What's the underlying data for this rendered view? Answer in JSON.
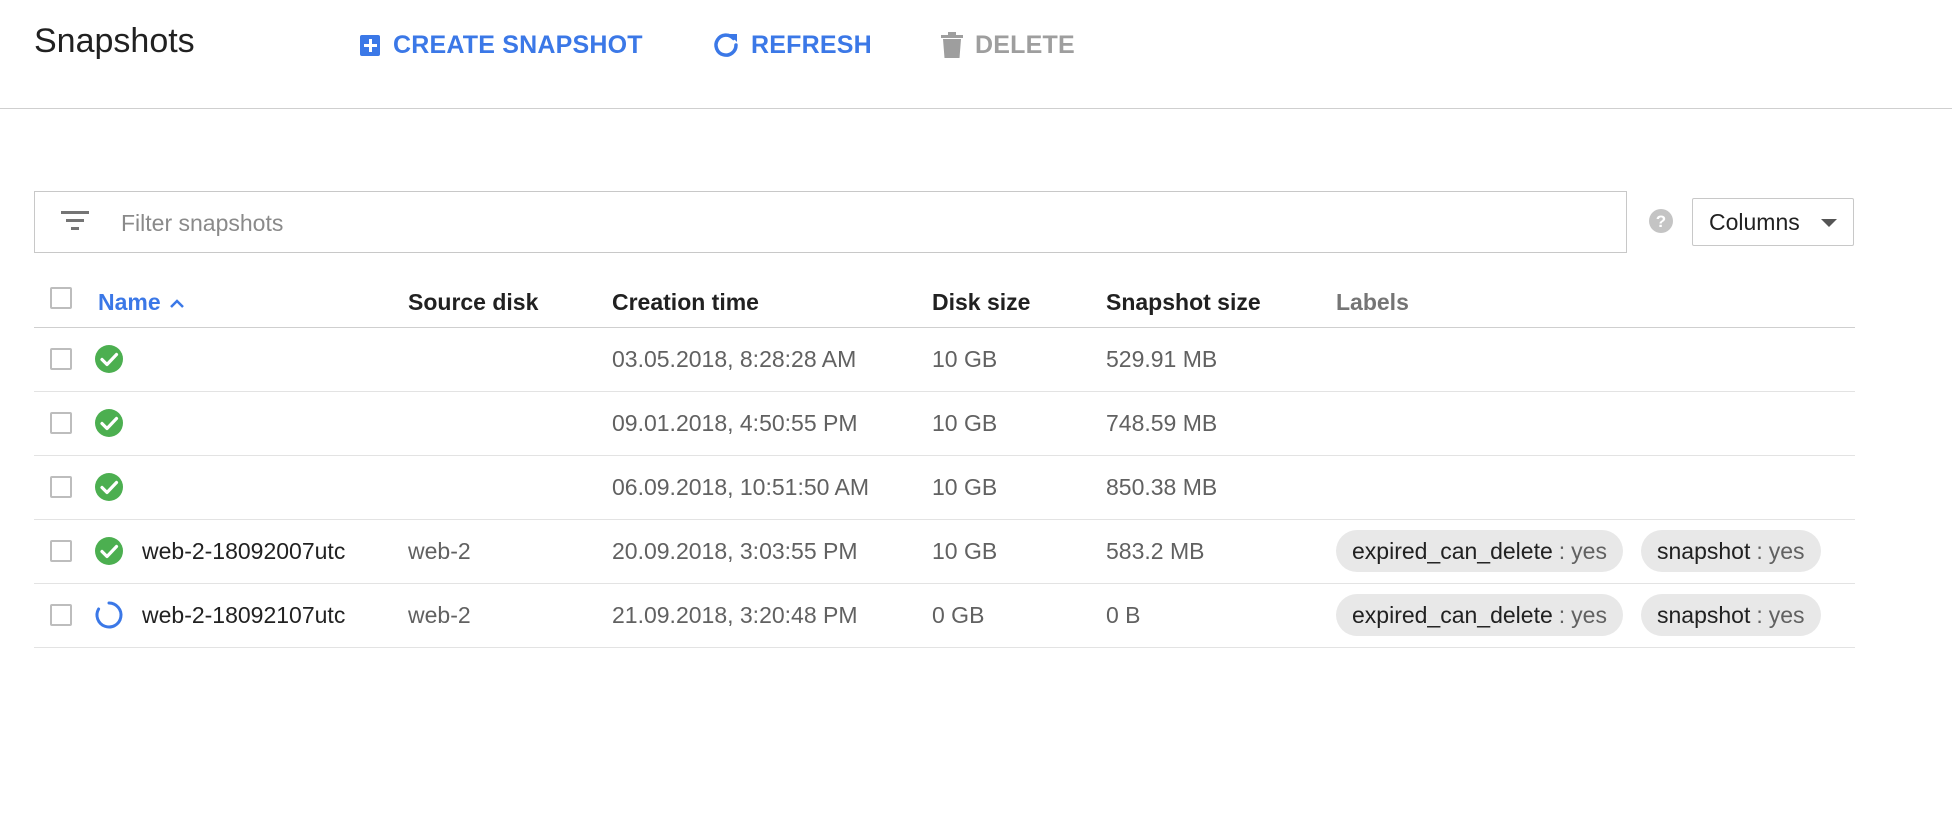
{
  "page": {
    "title": "Snapshots"
  },
  "toolbar": {
    "create_label": "CREATE SNAPSHOT",
    "refresh_label": "REFRESH",
    "delete_label": "DELETE"
  },
  "filter": {
    "placeholder": "Filter snapshots"
  },
  "columns_button": {
    "label": "Columns"
  },
  "table": {
    "headers": {
      "name": "Name",
      "source_disk": "Source disk",
      "creation_time": "Creation time",
      "disk_size": "Disk size",
      "snapshot_size": "Snapshot size",
      "labels": "Labels"
    },
    "rows": [
      {
        "status": "ready",
        "name": "",
        "source_disk": "",
        "creation_time": "03.05.2018, 8:28:28 AM",
        "disk_size": "10 GB",
        "snapshot_size": "529.91 MB",
        "labels": []
      },
      {
        "status": "ready",
        "name": "",
        "source_disk": "",
        "creation_time": "09.01.2018, 4:50:55 PM",
        "disk_size": "10 GB",
        "snapshot_size": "748.59 MB",
        "labels": []
      },
      {
        "status": "ready",
        "name": "",
        "source_disk": "",
        "creation_time": "06.09.2018, 10:51:50 AM",
        "disk_size": "10 GB",
        "snapshot_size": "850.38 MB",
        "labels": []
      },
      {
        "status": "ready",
        "name": "web-2-18092007utc",
        "source_disk": "web-2",
        "creation_time": "20.09.2018, 3:03:55 PM",
        "disk_size": "10 GB",
        "snapshot_size": "583.2 MB",
        "labels": [
          {
            "key": "expired_can_delete",
            "sep": ":",
            "value": "yes"
          },
          {
            "key": "snapshot",
            "sep": ":",
            "value": "yes"
          }
        ]
      },
      {
        "status": "pending",
        "name": "web-2-18092107utc",
        "source_disk": "web-2",
        "creation_time": "21.09.2018, 3:20:48 PM",
        "disk_size": "0 GB",
        "snapshot_size": "0 B",
        "labels": [
          {
            "key": "expired_can_delete",
            "sep": ":",
            "value": "yes"
          },
          {
            "key": "snapshot",
            "sep": ":",
            "value": "yes"
          }
        ]
      }
    ]
  },
  "colors": {
    "accent": "#3b78e7",
    "success": "#4caf50",
    "disabled": "#9e9e9e",
    "chip_bg": "#e8e8e8"
  },
  "icons": {
    "create": "add-box-icon",
    "refresh": "refresh-icon",
    "delete": "trash-icon",
    "filter": "filter-list-icon",
    "help": "help-circle-icon",
    "ready": "check-circle-icon",
    "pending": "spinner-icon"
  }
}
